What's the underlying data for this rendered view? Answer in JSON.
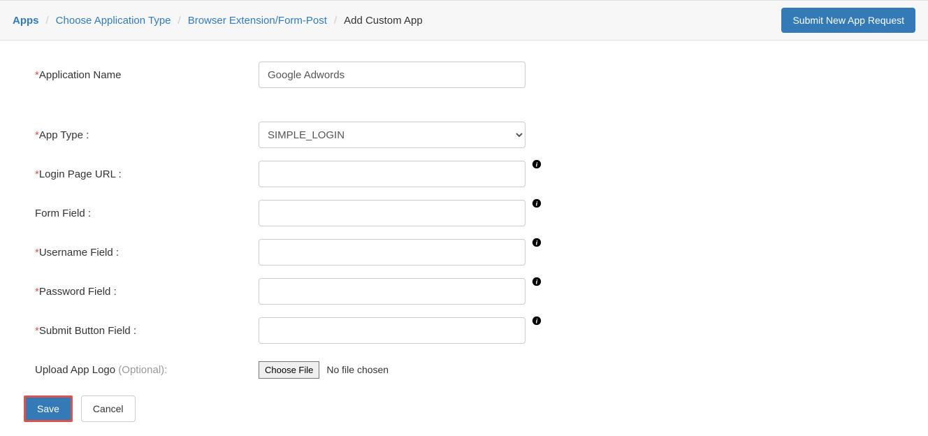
{
  "breadcrumb": {
    "apps": "Apps",
    "choose_type": "Choose Application Type",
    "browser_ext": "Browser Extension/Form-Post",
    "add_custom": "Add Custom App"
  },
  "header": {
    "submit_request": "Submit New App Request"
  },
  "form": {
    "app_name_label": "Application Name",
    "app_name_value": "Google Adwords",
    "app_type_label": "App Type :",
    "app_type_value": "SIMPLE_LOGIN",
    "login_url_label": "Login Page URL :",
    "login_url_value": "",
    "form_field_label": "Form Field :",
    "form_field_value": "",
    "username_label": "Username Field :",
    "username_value": "",
    "password_label": "Password Field :",
    "password_value": "",
    "submit_btn_label": "Submit Button Field :",
    "submit_btn_value": "",
    "upload_label": "Upload App Logo ",
    "upload_optional": "(Optional):",
    "choose_file": "Choose File",
    "no_file": "No file chosen"
  },
  "buttons": {
    "save": "Save",
    "cancel": "Cancel"
  }
}
